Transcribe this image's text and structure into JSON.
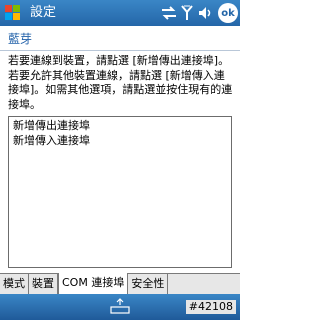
{
  "titlebar": {
    "title": "設定",
    "icons": [
      "windows-start-icon",
      "connectivity-icon",
      "signal-icon",
      "volume-icon",
      "ok-icon"
    ],
    "ok_label": "ok",
    "accent": "#2466a8"
  },
  "heading": "藍芽",
  "instructions": "若要連線到裝置，請點選 [新增傳出連接埠]。若要允許其他裝置連線，請點選 [新增傳入連接埠]。如需其他選項，請點選並按住現有的連接埠。",
  "ports": [
    {
      "label": "新增傳出連接埠"
    },
    {
      "label": "新增傳入連接埠"
    }
  ],
  "tabs": [
    {
      "label": "模式",
      "active": false
    },
    {
      "label": "裝置",
      "active": false
    },
    {
      "label": "COM 連接埠",
      "active": true
    },
    {
      "label": "安全性",
      "active": false
    }
  ],
  "menubar": {
    "icon": "keyboard-icon",
    "tag": "#42108"
  }
}
